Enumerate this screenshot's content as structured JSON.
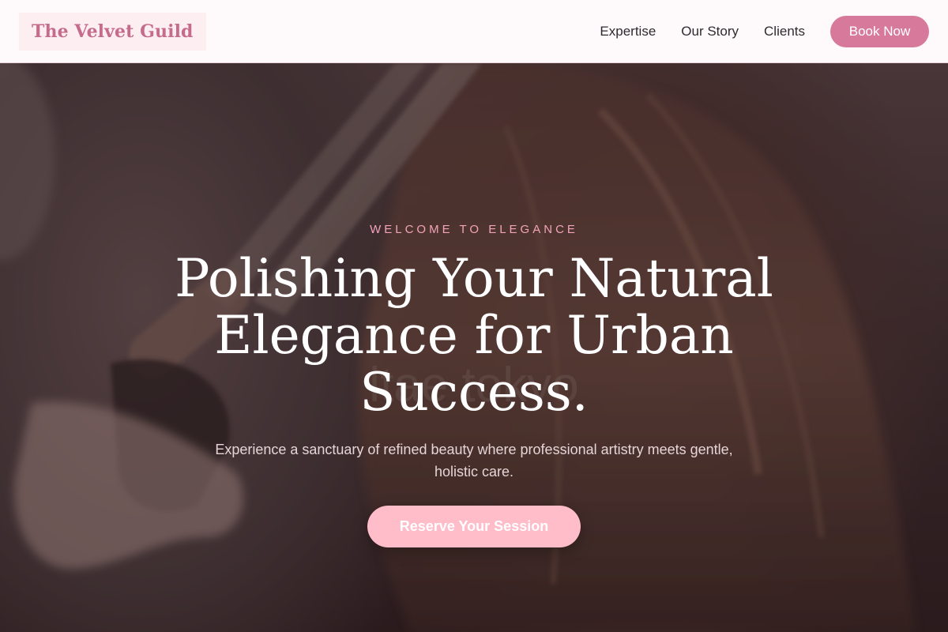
{
  "header": {
    "logo_text": "The Velvet Guild",
    "nav": [
      {
        "label": "Expertise"
      },
      {
        "label": "Our Story"
      },
      {
        "label": "Clients"
      }
    ],
    "cta_label": "Book Now"
  },
  "hero": {
    "eyebrow": "WELCOME TO ELEGANCE",
    "headline": "Polishing Your Natural Elegance for Urban Success.",
    "subtext": "Experience a sanctuary of refined beauty where professional artistry meets gentle, holistic care.",
    "cta_label": "Reserve Your Session",
    "background_watermark": "ltae tokyo"
  },
  "colors": {
    "brand_pink": "#d7799a",
    "logo_text": "#c56b8c",
    "eyebrow": "#f2a3bb",
    "cta_light_pink": "#ffbcc9",
    "header_bg": "#fefafb"
  }
}
